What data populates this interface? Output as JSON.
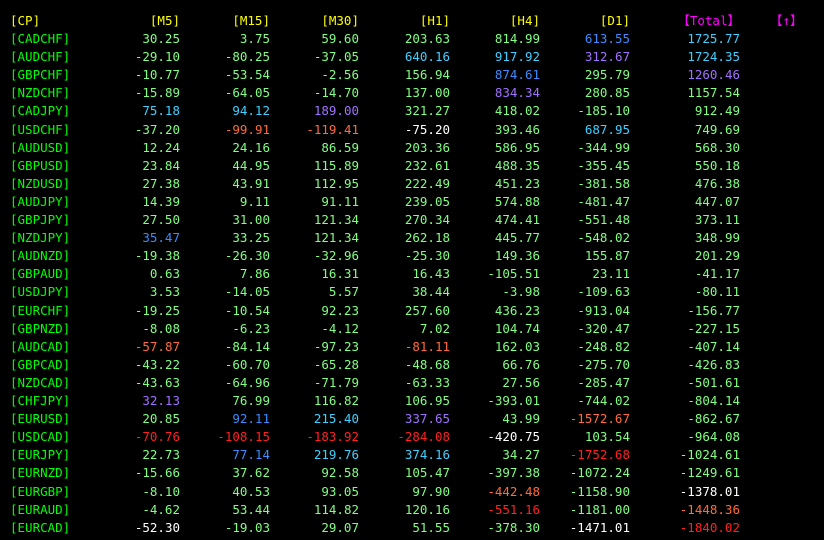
{
  "colors": {
    "header": "#ffff00",
    "header_total": "#ff00ff",
    "sort_button": "#ff00ff",
    "pair": "#00ff00",
    "light_green": "#40ff40",
    "pale_green": "#80ff80",
    "cyan": "#40d0ff",
    "blue": "#3a8cff",
    "lilac": "#a070ff",
    "white": "#ffffff",
    "orange": "#ff6a3a",
    "red": "#ff2020",
    "pink": "#ff4040"
  },
  "headers": [
    "[CP]",
    "[M5]",
    "[M15]",
    "[M30]",
    "[H1]",
    "[H4]",
    "[D1]",
    "【Total】"
  ],
  "sort_button": "【↑】",
  "rows": [
    {
      "pair": "[CADCHF]",
      "vals": [
        [
          "30.25",
          "pg"
        ],
        [
          "3.75",
          "pg"
        ],
        [
          "59.60",
          "pg"
        ],
        [
          "203.63",
          "pg"
        ],
        [
          "814.99",
          "pg"
        ],
        [
          "613.55",
          "bl"
        ],
        [
          "1725.77",
          "cy"
        ]
      ]
    },
    {
      "pair": "[AUDCHF]",
      "vals": [
        [
          "-29.10",
          "pg"
        ],
        [
          "-80.25",
          "pg"
        ],
        [
          "-37.05",
          "pg"
        ],
        [
          "640.16",
          "cy"
        ],
        [
          "917.92",
          "cy"
        ],
        [
          "312.67",
          "li"
        ],
        [
          "1724.35",
          "cy"
        ]
      ]
    },
    {
      "pair": "[GBPCHF]",
      "vals": [
        [
          "-10.77",
          "pg"
        ],
        [
          "-53.54",
          "pg"
        ],
        [
          "-2.56",
          "pg"
        ],
        [
          "156.94",
          "pg"
        ],
        [
          "874.61",
          "bl"
        ],
        [
          "295.79",
          "pg"
        ],
        [
          "1260.46",
          "li"
        ]
      ]
    },
    {
      "pair": "[NZDCHF]",
      "vals": [
        [
          "-15.89",
          "pg"
        ],
        [
          "-64.05",
          "pg"
        ],
        [
          "-14.70",
          "pg"
        ],
        [
          "137.00",
          "pg"
        ],
        [
          "834.34",
          "li"
        ],
        [
          "280.85",
          "pg"
        ],
        [
          "1157.54",
          "pg"
        ]
      ]
    },
    {
      "pair": "[CADJPY]",
      "vals": [
        [
          "75.18",
          "cy"
        ],
        [
          "94.12",
          "cy"
        ],
        [
          "189.00",
          "li"
        ],
        [
          "321.27",
          "pg"
        ],
        [
          "418.02",
          "pg"
        ],
        [
          "-185.10",
          "pg"
        ],
        [
          "912.49",
          "pg"
        ]
      ]
    },
    {
      "pair": "[USDCHF]",
      "vals": [
        [
          "-37.20",
          "pg"
        ],
        [
          "-99.91",
          "or"
        ],
        [
          "-119.41",
          "or"
        ],
        [
          "-75.20",
          "wh"
        ],
        [
          "393.46",
          "pg"
        ],
        [
          "687.95",
          "cy"
        ],
        [
          "749.69",
          "pg"
        ]
      ]
    },
    {
      "pair": "[AUDUSD]",
      "vals": [
        [
          "12.24",
          "pg"
        ],
        [
          "24.16",
          "pg"
        ],
        [
          "86.59",
          "pg"
        ],
        [
          "203.36",
          "pg"
        ],
        [
          "586.95",
          "pg"
        ],
        [
          "-344.99",
          "pg"
        ],
        [
          "568.30",
          "pg"
        ]
      ]
    },
    {
      "pair": "[GBPUSD]",
      "vals": [
        [
          "23.84",
          "pg"
        ],
        [
          "44.95",
          "pg"
        ],
        [
          "115.89",
          "pg"
        ],
        [
          "232.61",
          "pg"
        ],
        [
          "488.35",
          "pg"
        ],
        [
          "-355.45",
          "pg"
        ],
        [
          "550.18",
          "pg"
        ]
      ]
    },
    {
      "pair": "[NZDUSD]",
      "vals": [
        [
          "27.38",
          "pg"
        ],
        [
          "43.91",
          "pg"
        ],
        [
          "112.95",
          "pg"
        ],
        [
          "222.49",
          "pg"
        ],
        [
          "451.23",
          "pg"
        ],
        [
          "-381.58",
          "pg"
        ],
        [
          "476.38",
          "pg"
        ]
      ]
    },
    {
      "pair": "[AUDJPY]",
      "vals": [
        [
          "14.39",
          "pg"
        ],
        [
          "9.11",
          "pg"
        ],
        [
          "91.11",
          "pg"
        ],
        [
          "239.05",
          "pg"
        ],
        [
          "574.88",
          "pg"
        ],
        [
          "-481.47",
          "pg"
        ],
        [
          "447.07",
          "pg"
        ]
      ]
    },
    {
      "pair": "[GBPJPY]",
      "vals": [
        [
          "27.50",
          "pg"
        ],
        [
          "31.00",
          "pg"
        ],
        [
          "121.34",
          "pg"
        ],
        [
          "270.34",
          "pg"
        ],
        [
          "474.41",
          "pg"
        ],
        [
          "-551.48",
          "pg"
        ],
        [
          "373.11",
          "pg"
        ]
      ]
    },
    {
      "pair": "[NZDJPY]",
      "vals": [
        [
          "35.47",
          "bl"
        ],
        [
          "33.25",
          "pg"
        ],
        [
          "121.34",
          "pg"
        ],
        [
          "262.18",
          "pg"
        ],
        [
          "445.77",
          "pg"
        ],
        [
          "-548.02",
          "pg"
        ],
        [
          "348.99",
          "pg"
        ]
      ]
    },
    {
      "pair": "[AUDNZD]",
      "vals": [
        [
          "-19.38",
          "pg"
        ],
        [
          "-26.30",
          "pg"
        ],
        [
          "-32.96",
          "pg"
        ],
        [
          "-25.30",
          "pg"
        ],
        [
          "149.36",
          "pg"
        ],
        [
          "155.87",
          "pg"
        ],
        [
          "201.29",
          "pg"
        ]
      ]
    },
    {
      "pair": "[GBPAUD]",
      "vals": [
        [
          "0.63",
          "pg"
        ],
        [
          "7.86",
          "pg"
        ],
        [
          "16.31",
          "pg"
        ],
        [
          "16.43",
          "pg"
        ],
        [
          "-105.51",
          "pg"
        ],
        [
          "23.11",
          "pg"
        ],
        [
          "-41.17",
          "pg"
        ]
      ]
    },
    {
      "pair": "[USDJPY]",
      "vals": [
        [
          "3.53",
          "pg"
        ],
        [
          "-14.05",
          "pg"
        ],
        [
          "5.57",
          "pg"
        ],
        [
          "38.44",
          "pg"
        ],
        [
          "-3.98",
          "pg"
        ],
        [
          "-109.63",
          "pg"
        ],
        [
          "-80.11",
          "pg"
        ]
      ]
    },
    {
      "pair": "[EURCHF]",
      "vals": [
        [
          "-19.25",
          "pg"
        ],
        [
          "-10.54",
          "pg"
        ],
        [
          "92.23",
          "pg"
        ],
        [
          "257.60",
          "pg"
        ],
        [
          "436.23",
          "pg"
        ],
        [
          "-913.04",
          "pg"
        ],
        [
          "-156.77",
          "pg"
        ]
      ]
    },
    {
      "pair": "[GBPNZD]",
      "vals": [
        [
          "-8.08",
          "pg"
        ],
        [
          "-6.23",
          "pg"
        ],
        [
          "-4.12",
          "pg"
        ],
        [
          "7.02",
          "pg"
        ],
        [
          "104.74",
          "pg"
        ],
        [
          "-320.47",
          "pg"
        ],
        [
          "-227.15",
          "pg"
        ]
      ]
    },
    {
      "pair": "[AUDCAD]",
      "vals": [
        [
          "-57.87",
          "or"
        ],
        [
          "-84.14",
          "pg"
        ],
        [
          "-97.23",
          "pg"
        ],
        [
          "-81.11",
          "or"
        ],
        [
          "162.03",
          "pg"
        ],
        [
          "-248.82",
          "pg"
        ],
        [
          "-407.14",
          "pg"
        ]
      ]
    },
    {
      "pair": "[GBPCAD]",
      "vals": [
        [
          "-43.22",
          "pg"
        ],
        [
          "-60.70",
          "pg"
        ],
        [
          "-65.28",
          "pg"
        ],
        [
          "-48.68",
          "pg"
        ],
        [
          "66.76",
          "pg"
        ],
        [
          "-275.70",
          "pg"
        ],
        [
          "-426.83",
          "pg"
        ]
      ]
    },
    {
      "pair": "[NZDCAD]",
      "vals": [
        [
          "-43.63",
          "pg"
        ],
        [
          "-64.96",
          "pg"
        ],
        [
          "-71.79",
          "pg"
        ],
        [
          "-63.33",
          "pg"
        ],
        [
          "27.56",
          "pg"
        ],
        [
          "-285.47",
          "pg"
        ],
        [
          "-501.61",
          "pg"
        ]
      ]
    },
    {
      "pair": "[CHFJPY]",
      "vals": [
        [
          "32.13",
          "li"
        ],
        [
          "76.99",
          "pg"
        ],
        [
          "116.82",
          "pg"
        ],
        [
          "106.95",
          "pg"
        ],
        [
          "-393.01",
          "pg"
        ],
        [
          "-744.02",
          "pg"
        ],
        [
          "-804.14",
          "pg"
        ]
      ]
    },
    {
      "pair": "[EURUSD]",
      "vals": [
        [
          "20.85",
          "pg"
        ],
        [
          "92.11",
          "bl"
        ],
        [
          "215.40",
          "cy"
        ],
        [
          "337.65",
          "li"
        ],
        [
          "43.99",
          "pg"
        ],
        [
          "-1572.67",
          "or"
        ],
        [
          "-862.67",
          "pg"
        ]
      ]
    },
    {
      "pair": "[USDCAD]",
      "vals": [
        [
          "-70.76",
          "re"
        ],
        [
          "-108.15",
          "re"
        ],
        [
          "-183.92",
          "re"
        ],
        [
          "-284.08",
          "re"
        ],
        [
          "-420.75",
          "wh"
        ],
        [
          "103.54",
          "pg"
        ],
        [
          "-964.08",
          "pg"
        ]
      ]
    },
    {
      "pair": "[EURJPY]",
      "vals": [
        [
          "22.73",
          "pg"
        ],
        [
          "77.14",
          "bl"
        ],
        [
          "219.76",
          "cy"
        ],
        [
          "374.16",
          "cy"
        ],
        [
          "34.27",
          "pg"
        ],
        [
          "-1752.68",
          "re"
        ],
        [
          "-1024.61",
          "pg"
        ]
      ]
    },
    {
      "pair": "[EURNZD]",
      "vals": [
        [
          "-15.66",
          "pg"
        ],
        [
          "37.62",
          "pg"
        ],
        [
          "92.58",
          "pg"
        ],
        [
          "105.47",
          "pg"
        ],
        [
          "-397.38",
          "pg"
        ],
        [
          "-1072.24",
          "pg"
        ],
        [
          "-1249.61",
          "pg"
        ]
      ]
    },
    {
      "pair": "[EURGBP]",
      "vals": [
        [
          "-8.10",
          "pg"
        ],
        [
          "40.53",
          "pg"
        ],
        [
          "93.05",
          "pg"
        ],
        [
          "97.90",
          "pg"
        ],
        [
          "-442.48",
          "or"
        ],
        [
          "-1158.90",
          "pg"
        ],
        [
          "-1378.01",
          "wh"
        ]
      ]
    },
    {
      "pair": "[EURAUD]",
      "vals": [
        [
          "-4.62",
          "pg"
        ],
        [
          "53.44",
          "pg"
        ],
        [
          "114.82",
          "pg"
        ],
        [
          "120.16",
          "pg"
        ],
        [
          "-551.16",
          "re"
        ],
        [
          "-1181.00",
          "pg"
        ],
        [
          "-1448.36",
          "or"
        ]
      ]
    },
    {
      "pair": "[EURCAD]",
      "vals": [
        [
          "-52.30",
          "wh"
        ],
        [
          "-19.03",
          "pg"
        ],
        [
          "29.07",
          "pg"
        ],
        [
          "51.55",
          "pg"
        ],
        [
          "-378.30",
          "pg"
        ],
        [
          "-1471.01",
          "wh"
        ],
        [
          "-1840.02",
          "re"
        ]
      ]
    }
  ]
}
